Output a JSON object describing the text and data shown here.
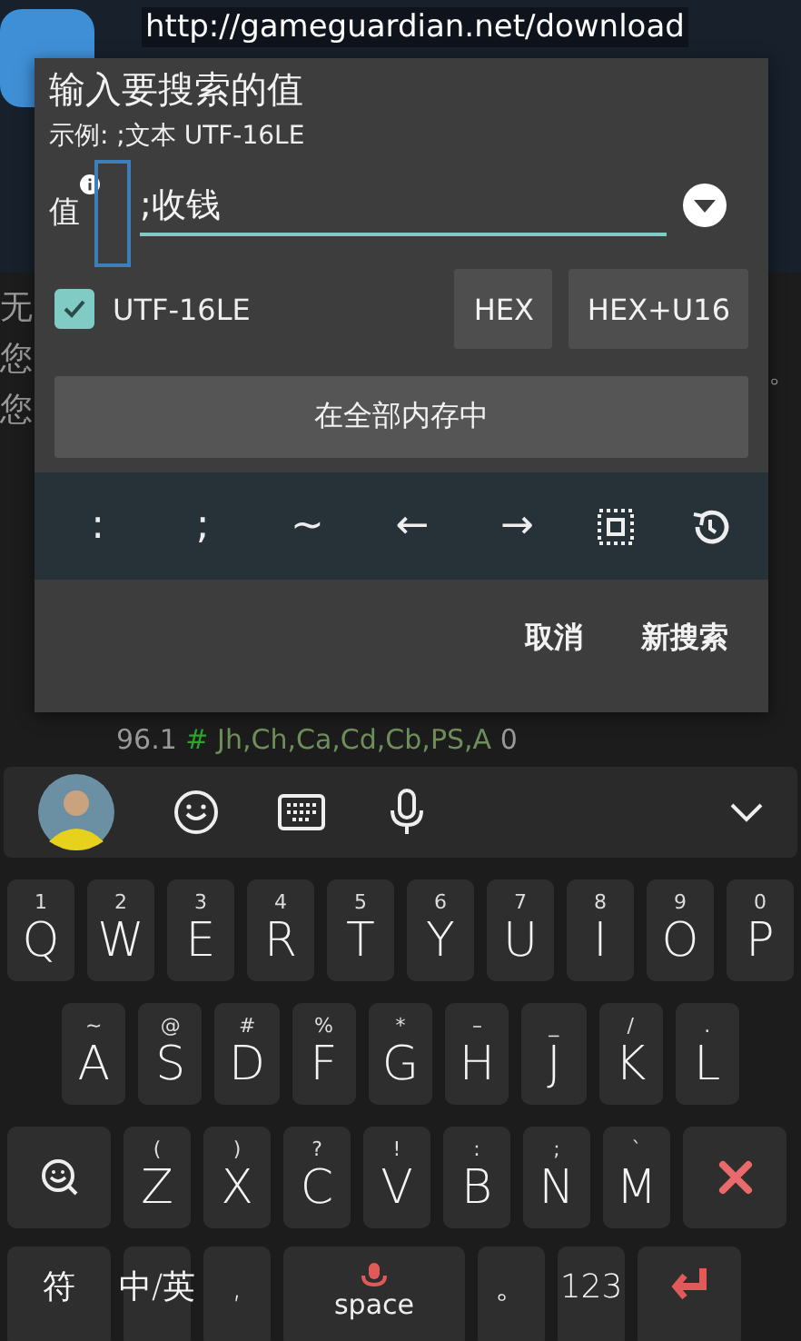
{
  "banner": {
    "url": "http://gameguardian.net/download"
  },
  "background": {
    "side_texts": [
      "无",
      "您",
      "您"
    ],
    "right_text": "。",
    "result_line": {
      "value": "96.1",
      "hash": "#",
      "flags": "Jh,Ch,Ca,Cd,Cb,PS,A",
      "count": "0"
    }
  },
  "dialog": {
    "title": "输入要搜索的值",
    "example": "示例: ;文本 UTF-16LE",
    "value_label": "值",
    "value": ";收钱",
    "utf16le": {
      "label": "UTF-16LE",
      "checked": true
    },
    "type_buttons": [
      "HEX",
      "HEX+U16"
    ],
    "memory_button": "在全部内存中",
    "symbols": [
      {
        "kind": "text",
        "text": ":"
      },
      {
        "kind": "text",
        "text": ";"
      },
      {
        "kind": "text",
        "text": "~"
      },
      {
        "kind": "text",
        "text": "←"
      },
      {
        "kind": "text",
        "text": "→"
      },
      {
        "kind": "select"
      },
      {
        "kind": "history"
      }
    ],
    "actions": [
      "取消",
      "新搜索"
    ]
  },
  "keyboard": {
    "letter_rows": [
      [
        {
          "kind": "char",
          "main": "Q",
          "hint": "1"
        },
        {
          "kind": "char",
          "main": "W",
          "hint": "2"
        },
        {
          "kind": "char",
          "main": "E",
          "hint": "3"
        },
        {
          "kind": "char",
          "main": "R",
          "hint": "4"
        },
        {
          "kind": "char",
          "main": "T",
          "hint": "5"
        },
        {
          "kind": "char",
          "main": "Y",
          "hint": "6"
        },
        {
          "kind": "char",
          "main": "U",
          "hint": "7"
        },
        {
          "kind": "char",
          "main": "I",
          "hint": "8"
        },
        {
          "kind": "char",
          "main": "O",
          "hint": "9"
        },
        {
          "kind": "char",
          "main": "P",
          "hint": "0"
        }
      ],
      [
        {
          "kind": "char",
          "main": "A",
          "hint": "~"
        },
        {
          "kind": "char",
          "main": "S",
          "hint": "@"
        },
        {
          "kind": "char",
          "main": "D",
          "hint": "#"
        },
        {
          "kind": "char",
          "main": "F",
          "hint": "%"
        },
        {
          "kind": "char",
          "main": "G",
          "hint": "*"
        },
        {
          "kind": "char",
          "main": "H",
          "hint": "–"
        },
        {
          "kind": "char",
          "main": "J",
          "hint": "_"
        },
        {
          "kind": "char",
          "main": "K",
          "hint": "/"
        },
        {
          "kind": "char",
          "main": "L",
          "hint": "."
        }
      ],
      [
        {
          "kind": "emoji"
        },
        {
          "kind": "char",
          "main": "Z",
          "hint": "("
        },
        {
          "kind": "char",
          "main": "X",
          "hint": ")"
        },
        {
          "kind": "char",
          "main": "C",
          "hint": "?"
        },
        {
          "kind": "char",
          "main": "V",
          "hint": "!"
        },
        {
          "kind": "char",
          "main": "B",
          "hint": ":"
        },
        {
          "kind": "char",
          "main": "N",
          "hint": ";"
        },
        {
          "kind": "char",
          "main": "M",
          "hint": "`"
        },
        {
          "kind": "delete"
        }
      ]
    ],
    "bottom_row": [
      {
        "kind": "wide",
        "main": "符"
      },
      {
        "kind": "small",
        "main": "中/英"
      },
      {
        "kind": "small",
        "main": ","
      },
      {
        "kind": "space",
        "main": "space"
      },
      {
        "kind": "small",
        "main": "。"
      },
      {
        "kind": "small",
        "main": "123"
      },
      {
        "kind": "enter"
      }
    ]
  }
}
